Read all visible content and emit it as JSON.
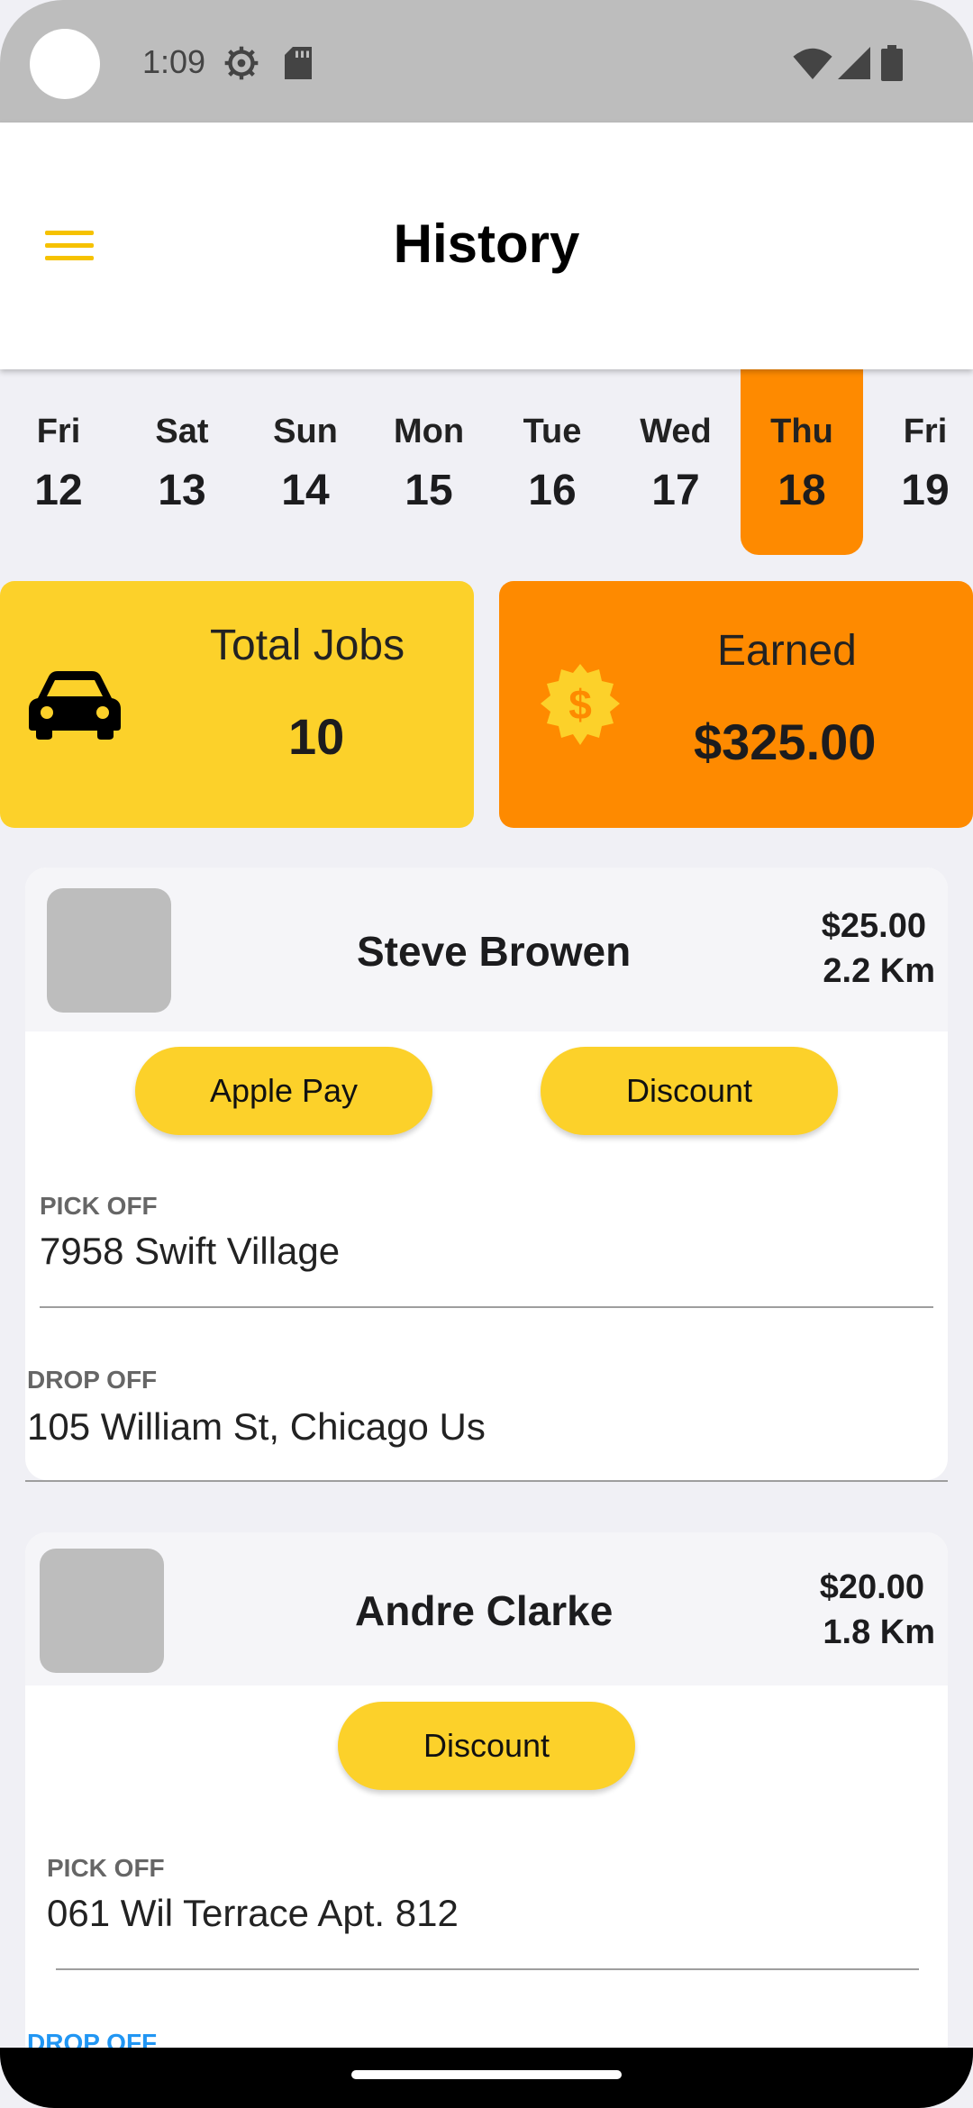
{
  "status_bar": {
    "time": "1:09"
  },
  "app_bar": {
    "title": "History"
  },
  "days": [
    {
      "name": "Fri",
      "date": "12"
    },
    {
      "name": "Sat",
      "date": "13"
    },
    {
      "name": "Sun",
      "date": "14"
    },
    {
      "name": "Mon",
      "date": "15"
    },
    {
      "name": "Tue",
      "date": "16"
    },
    {
      "name": "Wed",
      "date": "17"
    },
    {
      "name": "Thu",
      "date": "18",
      "selected": true
    },
    {
      "name": "Fri",
      "date": "19"
    }
  ],
  "stats": {
    "total_jobs_label": "Total Jobs",
    "total_jobs_value": "10",
    "earned_label": "Earned",
    "earned_value": "$325.00"
  },
  "rides": [
    {
      "name": "Steve Browen",
      "price": "$25.00",
      "distance": "2.2 Km",
      "buttons": [
        "Apple Pay",
        "Discount"
      ],
      "pickup_label": "PICK OFF",
      "pickup": "7958 Swift Village",
      "dropoff_label": "DROP OFF",
      "dropoff": "105 William St, Chicago Us"
    },
    {
      "name": "Andre Clarke",
      "price": "$20.00",
      "distance": "1.8 Km",
      "buttons": [
        "Discount"
      ],
      "pickup_label": "PICK OFF",
      "pickup": "061 Wil Terrace Apt. 812",
      "dropoff_label": "DROP OFF"
    }
  ],
  "colors": {
    "accent_yellow": "#fcd12a",
    "accent_orange": "#fe8a00",
    "link_blue": "#2196f3"
  },
  "icons": [
    "settings-icon",
    "sd-card-icon",
    "wifi-icon",
    "signal-icon",
    "battery-icon",
    "menu-icon",
    "car-icon",
    "dollar-badge-icon"
  ]
}
